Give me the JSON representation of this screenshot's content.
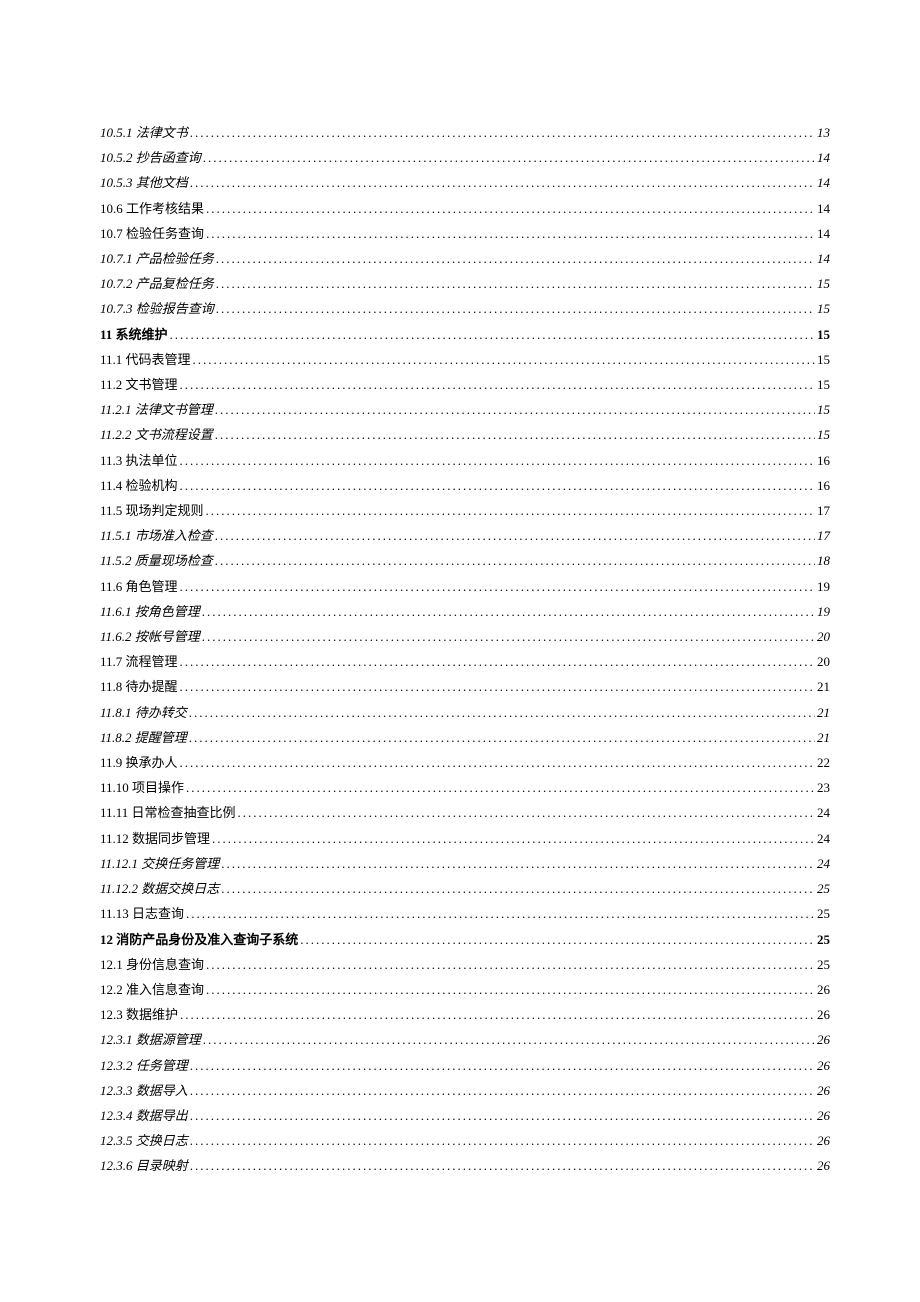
{
  "toc": [
    {
      "level": "h3",
      "number": "10.5.1",
      "text": "法律文书",
      "page": "13"
    },
    {
      "level": "h3",
      "number": "10.5.2",
      "text": "抄告函查询",
      "page": "14"
    },
    {
      "level": "h3",
      "number": "10.5.3",
      "text": "其他文档",
      "page": "14"
    },
    {
      "level": "h2",
      "number": "10.6",
      "text": "工作考核结果",
      "page": "14"
    },
    {
      "level": "h2",
      "number": "10.7",
      "text": "检验任务查询",
      "page": "14"
    },
    {
      "level": "h3",
      "number": "10.7.1",
      "text": "产品检验任务",
      "page": "14"
    },
    {
      "level": "h3",
      "number": "10.7.2",
      "text": "产品复检任务",
      "page": "15"
    },
    {
      "level": "h3",
      "number": "10.7.3",
      "text": "检验报告查询",
      "page": "15"
    },
    {
      "level": "h1",
      "number": "11",
      "text": "系统维护",
      "page": "15"
    },
    {
      "level": "h2",
      "number": "11.1",
      "text": "代码表管理",
      "page": "15"
    },
    {
      "level": "h2",
      "number": "11.2",
      "text": "文书管理",
      "page": "15"
    },
    {
      "level": "h3",
      "number": "11.2.1",
      "text": "法律文书管理",
      "page": "15"
    },
    {
      "level": "h3",
      "number": "11.2.2",
      "text": "文书流程设置",
      "page": "15"
    },
    {
      "level": "h2",
      "number": "11.3",
      "text": "执法单位",
      "page": "16"
    },
    {
      "level": "h2",
      "number": "11.4",
      "text": "检验机构",
      "page": "16"
    },
    {
      "level": "h2",
      "number": "11.5",
      "text": "现场判定规则",
      "page": "17"
    },
    {
      "level": "h3",
      "number": "11.5.1",
      "text": "市场准入检查",
      "page": "17"
    },
    {
      "level": "h3",
      "number": "11.5.2",
      "text": "质量现场检查",
      "page": "18"
    },
    {
      "level": "h2",
      "number": "11.6",
      "text": "角色管理",
      "page": "19"
    },
    {
      "level": "h3",
      "number": "11.6.1",
      "text": "按角色管理",
      "page": "19"
    },
    {
      "level": "h3",
      "number": "11.6.2",
      "text": "按帐号管理",
      "page": "20"
    },
    {
      "level": "h2",
      "number": "11.7",
      "text": "流程管理",
      "page": "20"
    },
    {
      "level": "h2",
      "number": "11.8",
      "text": "待办提醒",
      "page": "21"
    },
    {
      "level": "h3",
      "number": "11.8.1",
      "text": "待办转交",
      "page": "21"
    },
    {
      "level": "h3",
      "number": "11.8.2",
      "text": "提醒管理",
      "page": "21"
    },
    {
      "level": "h2",
      "number": "11.9",
      "text": "换承办人",
      "page": "22"
    },
    {
      "level": "h2",
      "number": "11.10",
      "text": "项目操作",
      "page": "23"
    },
    {
      "level": "h2",
      "number": "11.11",
      "text": "日常检查抽查比例",
      "page": "24"
    },
    {
      "level": "h2",
      "number": "11.12",
      "text": "数据同步管理",
      "page": "24"
    },
    {
      "level": "h3",
      "number": "11.12.1",
      "text": "交换任务管理",
      "page": "24"
    },
    {
      "level": "h3",
      "number": "11.12.2",
      "text": "数据交换日志",
      "page": "25"
    },
    {
      "level": "h2",
      "number": "11.13",
      "text": "日志查询",
      "page": "25"
    },
    {
      "level": "h1",
      "number": "12",
      "text": "消防产品身份及准入查询子系统",
      "page": "25"
    },
    {
      "level": "h2",
      "number": "12.1",
      "text": "身份信息查询",
      "page": "25"
    },
    {
      "level": "h2",
      "number": "12.2",
      "text": "准入信息查询",
      "page": "26"
    },
    {
      "level": "h2",
      "number": "12.3",
      "text": "数据维护",
      "page": "26"
    },
    {
      "level": "h3",
      "number": "12.3.1",
      "text": "数据源管理",
      "page": "26"
    },
    {
      "level": "h3",
      "number": "12.3.2",
      "text": "任务管理",
      "page": "26"
    },
    {
      "level": "h3",
      "number": "12.3.3",
      "text": "数据导入",
      "page": "26"
    },
    {
      "level": "h3",
      "number": "12.3.4",
      "text": "数据导出",
      "page": "26"
    },
    {
      "level": "h3",
      "number": "12.3.5",
      "text": "交换日志",
      "page": "26"
    },
    {
      "level": "h3",
      "number": "12.3.6",
      "text": "目录映射",
      "page": "26"
    }
  ]
}
